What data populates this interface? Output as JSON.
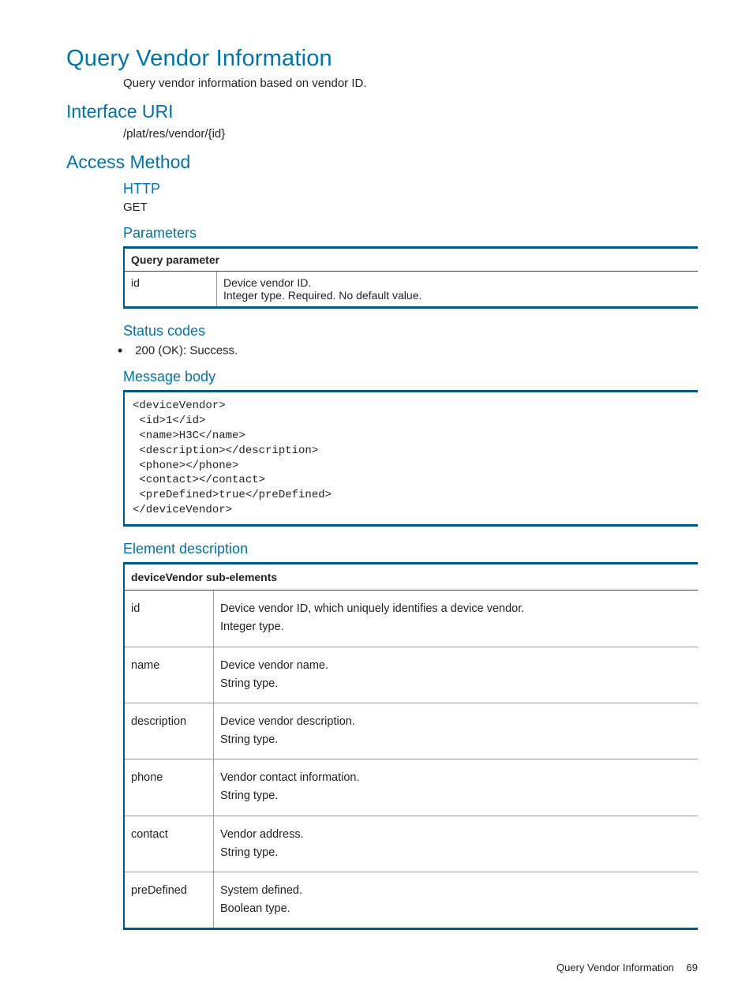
{
  "title": "Query Vendor Information",
  "intro": "Query vendor information based on vendor ID.",
  "interface_uri_heading": "Interface URI",
  "interface_uri": "/plat/res/vendor/{id}",
  "access_method_heading": "Access Method",
  "http_heading": "HTTP",
  "http_method": "GET",
  "parameters_heading": "Parameters",
  "param_table_header": "Query parameter",
  "param_name": "id",
  "param_desc_line1": "Device vendor ID.",
  "param_desc_line2": "Integer type. Required. No default value.",
  "status_codes_heading": "Status codes",
  "status_code_line": "200 (OK): Success.",
  "message_body_heading": "Message body",
  "message_body_code": "<deviceVendor>\n <id>1</id>\n <name>H3C</name>\n <description></description>\n <phone></phone>\n <contact></contact>\n <preDefined>true</preDefined>\n</deviceVendor>",
  "element_desc_heading": "Element description",
  "elem_table_header": "deviceVendor sub-elements",
  "elem_rows": {
    "r0": {
      "name": "id",
      "l1": "Device vendor ID, which uniquely identifies a device vendor.",
      "l2": "Integer type."
    },
    "r1": {
      "name": "name",
      "l1": "Device vendor name.",
      "l2": "String type."
    },
    "r2": {
      "name": "description",
      "l1": "Device vendor description.",
      "l2": "String type."
    },
    "r3": {
      "name": "phone",
      "l1": "Vendor contact information.",
      "l2": "String type."
    },
    "r4": {
      "name": "contact",
      "l1": "Vendor address.",
      "l2": "String type."
    },
    "r5": {
      "name": "preDefined",
      "l1": "System defined.",
      "l2": "Boolean type."
    }
  },
  "footer_title": "Query Vendor Information",
  "page_number": "69"
}
